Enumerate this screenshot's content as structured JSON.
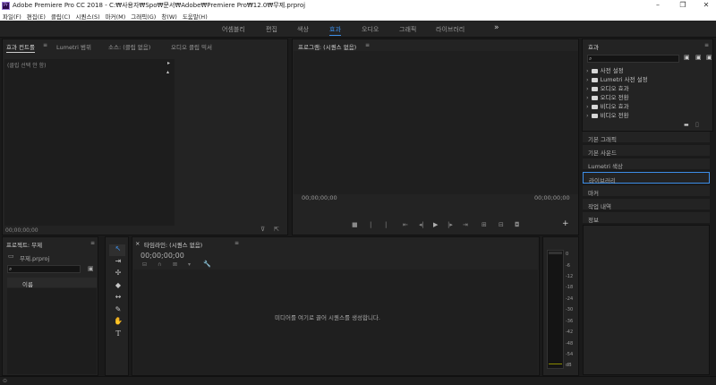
{
  "app": {
    "title": "Adobe Premiere Pro CC 2018 - C:₩사용자₩Spo₩문서₩Adobe₩Premiere Pro₩12.0₩무제.prproj",
    "icon": "Pr"
  },
  "menu": [
    "파일(F)",
    "편집(E)",
    "클립(C)",
    "시퀀스(S)",
    "마커(M)",
    "그래픽(G)",
    "창(W)",
    "도움말(H)"
  ],
  "workspaces": {
    "items": [
      "어셈블리",
      "편집",
      "색상",
      "효과",
      "오디오",
      "그래픽",
      "라이브러리"
    ],
    "active": "효과",
    "more": "»"
  },
  "source_panel": {
    "tabs": [
      "효과 컨트롤",
      "Lumetri 범위",
      "소스: (클립 없음)",
      "오디오 클립 믹서"
    ],
    "menu_glyph": "≡",
    "placeholder": "(클립 선택 안 함)",
    "timecode": "00;00;00;00"
  },
  "program_panel": {
    "title": "프로그램: (시퀀스 없음)",
    "menu_glyph": "≡",
    "timecode_left": "00;00;00;00",
    "timecode_right": "00;00;00;00",
    "add_glyph": "+"
  },
  "project_panel": {
    "title": "프로젝트: 무제",
    "menu_glyph": "≡",
    "file": "무제.prproj",
    "column_name": "이름"
  },
  "timeline_panel": {
    "title": "타임라인: (시퀀스 없음)",
    "menu_glyph": "≡",
    "close_glyph": "×",
    "timecode": "00;00;00;00",
    "empty_message": "미디어를 여기로 끌어 시퀀스를 생성합니다."
  },
  "effects_panel": {
    "title": "효과",
    "menu_glyph": "≡",
    "folders": [
      "사전 설정",
      "Lumetri 사전 설정",
      "오디오 효과",
      "오디오 전환",
      "비디오 효과",
      "비디오 전환"
    ]
  },
  "side_sections": {
    "items": [
      "기본 그래픽",
      "기본 사운드",
      "Lumetri 색상",
      "라이브러리",
      "마커",
      "작업 내역",
      "정보"
    ],
    "selected": "라이브러리"
  },
  "audio_meter": {
    "labels": [
      "0",
      "-6",
      "-12",
      "-18",
      "-24",
      "-30",
      "-36",
      "-42",
      "-48",
      "-54",
      "dB"
    ]
  },
  "colors": {
    "accent": "#3d8ee8",
    "panel": "#232323",
    "panel_dark": "#1d1d1d",
    "background": "#1a1a1a"
  }
}
